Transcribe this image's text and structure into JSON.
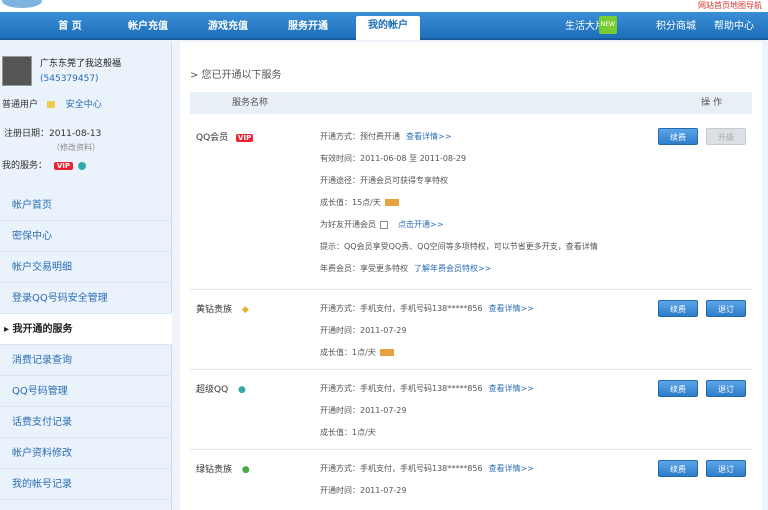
{
  "top": {
    "right_link": "网站首页地图导航"
  },
  "nav": {
    "items": [
      "首 页",
      "帐户充值",
      "游戏充值",
      "服务开通",
      "我的帐户"
    ],
    "active_index": 4,
    "right": [
      "生活大片",
      "积分商城",
      "帮助中心"
    ],
    "new_badge": "NEW"
  },
  "user": {
    "name": "广东东莞了我这般福",
    "uid": "(545379457)",
    "level_text": "普通用户",
    "center_link": "安全中心",
    "reg_date": "注册日期：2011-08-13",
    "reg_link": "（修改资料）",
    "vip_label": "我的服务：",
    "vip_badge": "VIP"
  },
  "menu": {
    "items": [
      "帐户首页",
      "密保中心",
      "帐户交易明细",
      "登录QQ号码安全管理",
      "我开通的服务",
      "消费记录查询",
      "QQ号码管理",
      "话费支付记录",
      "帐户资料修改",
      "我的帐号记录"
    ],
    "active_index": 4
  },
  "main": {
    "breadcrumb": "> 您已开通以下服务",
    "col_name": "服务名称",
    "col_op": "操 作",
    "services": [
      {
        "name": "QQ会员",
        "badge": "VIP",
        "badge_color": "#e23",
        "lines": [
          {
            "text": "开通方式：预付费开通",
            "link": "查看详情>>"
          },
          {
            "text": "有效时间：2011-06-08 至 2011-08-29",
            "link": ""
          },
          {
            "text": "开通途径：开通会员可获得专享特权",
            "link": ""
          },
          {
            "text": "成长值：15点/天",
            "link": ""
          },
          {
            "text": "为好友开通会员",
            "link": "点击开通>>"
          },
          {
            "text": "提示：QQ会员享受QQ秀、QQ空间等多项特权，可以节省更多开支，查看详情",
            "link": ""
          },
          {
            "text": "年费会员：享受更多特权",
            "link": "了解年费会员特权>>"
          }
        ],
        "buttons": [
          "续费",
          "升级"
        ],
        "second_disabled": true
      },
      {
        "name": "黄钻贵族",
        "badge": "◆",
        "badge_color": "#e8b020",
        "lines": [
          {
            "text": "开通方式：手机支付，手机号码138*****856",
            "link": "查看详情>>"
          },
          {
            "text": "开通时间：2011-07-29",
            "link": ""
          },
          {
            "text": "成长值：1点/天",
            "link": ""
          }
        ],
        "buttons": [
          "续费",
          "退订"
        ],
        "second_disabled": false
      },
      {
        "name": "超级QQ",
        "badge": "●",
        "badge_color": "#3aa",
        "lines": [
          {
            "text": "开通方式：手机支付，手机号码138*****856",
            "link": "查看详情>>"
          },
          {
            "text": "开通时间：2011-07-29",
            "link": ""
          },
          {
            "text": "成长值：1点/天",
            "link": ""
          }
        ],
        "buttons": [
          "续费",
          "退订"
        ],
        "second_disabled": false
      },
      {
        "name": "绿钻贵族",
        "badge": "●",
        "badge_color": "#4a4",
        "lines": [
          {
            "text": "开通方式：手机支付，手机号码138*****856",
            "link": "查看详情>>"
          },
          {
            "text": "开通时间：2011-07-29",
            "link": ""
          }
        ],
        "buttons": [
          "续费",
          "退订"
        ],
        "second_disabled": false
      }
    ]
  }
}
